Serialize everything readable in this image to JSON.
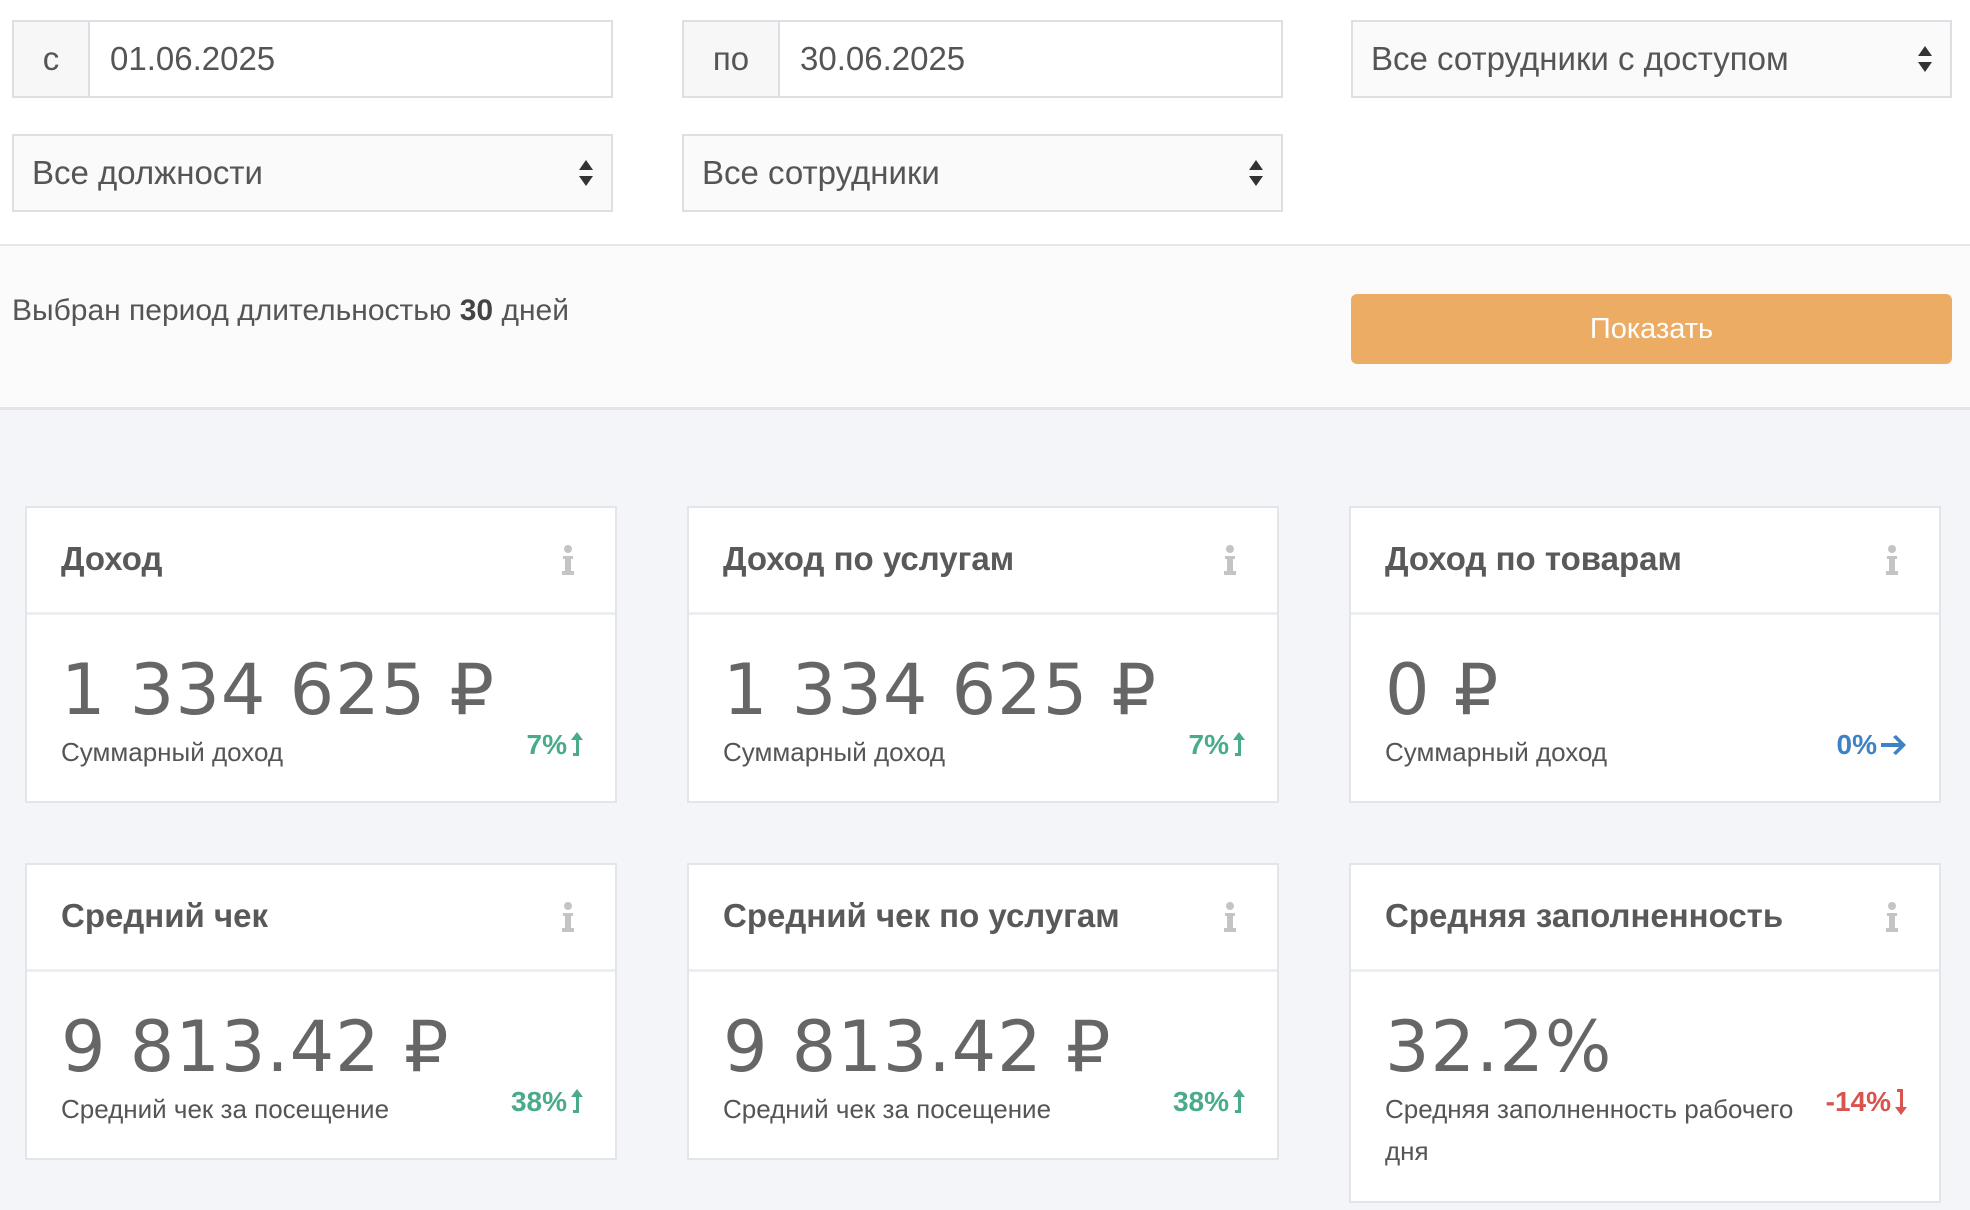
{
  "filters": {
    "from_prefix": "с",
    "from_date": "01.06.2025",
    "to_prefix": "по",
    "to_date": "30.06.2025",
    "access_select": "Все сотрудники с доступом",
    "positions_select": "Все должности",
    "employees_select": "Все сотрудники"
  },
  "action_bar": {
    "period_prefix": "Выбран период длительностью",
    "period_days": "30",
    "period_suffix": "дней",
    "show_button": "Показать"
  },
  "cards": [
    {
      "title": "Доход",
      "value": "1 334 625 ₽",
      "caption": "Суммарный доход",
      "delta": "7%",
      "trend": "up"
    },
    {
      "title": "Доход по услугам",
      "value": "1 334 625 ₽",
      "caption": "Суммарный доход",
      "delta": "7%",
      "trend": "up"
    },
    {
      "title": "Доход по товарам",
      "value": "0 ₽",
      "caption": "Суммарный доход",
      "delta": "0%",
      "trend": "flat"
    },
    {
      "title": "Средний чек",
      "value": "9 813.42 ₽",
      "caption": "Средний чек за посещение",
      "delta": "38%",
      "trend": "up"
    },
    {
      "title": "Средний чек по услугам",
      "value": "9 813.42 ₽",
      "caption": "Средний чек за посещение",
      "delta": "38%",
      "trend": "up"
    },
    {
      "title": "Средняя заполненность",
      "value": "32.2%",
      "caption": "Средняя заполненность рабочего дня",
      "delta": "-14%",
      "trend": "down"
    }
  ],
  "colors": {
    "accent_button": "#edac63",
    "trend_up": "#4aab88",
    "trend_flat": "#3d82c4",
    "trend_down": "#d9534f"
  },
  "icons": {
    "info": "info-icon",
    "select_arrows": "select-arrows-icon",
    "trend_up": "arrow-up-icon",
    "trend_flat": "arrow-right-icon",
    "trend_down": "arrow-down-icon"
  }
}
